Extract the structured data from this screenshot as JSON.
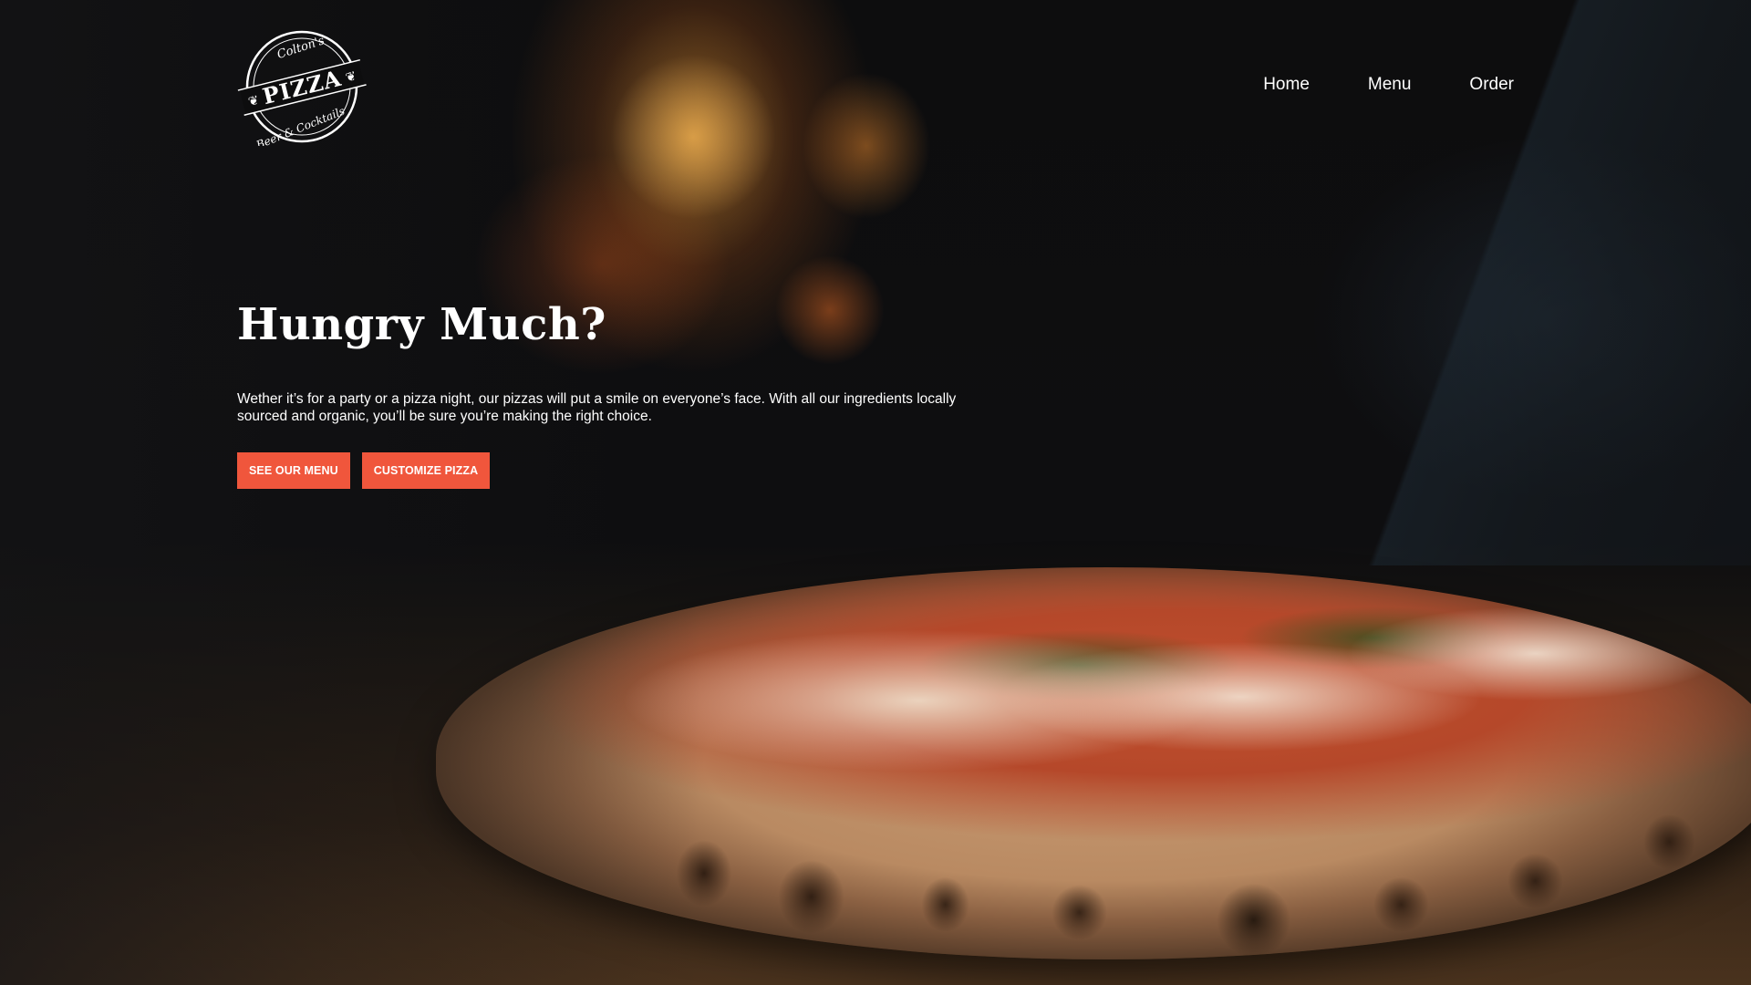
{
  "brand": {
    "logo_top": "Colton's",
    "logo_main": "PIZZA",
    "logo_bottom": "Beer & Cocktails"
  },
  "nav": {
    "items": [
      {
        "label": "Home"
      },
      {
        "label": "Menu"
      },
      {
        "label": "Order"
      }
    ]
  },
  "hero": {
    "headline": "Hungry Much?",
    "description": "Wether it’s for a party or a pizza night, our pizzas will put a smile on everyone’s face. With all our ingredients locally sourced and organic, you’ll be sure you’re making the right choice.",
    "buttons": {
      "menu": "SEE OUR MENU",
      "customize": "CUSTOMIZE PIZZA"
    }
  },
  "colors": {
    "accent": "#f0563c",
    "text": "#ffffff",
    "background": "#0d0d0e"
  }
}
